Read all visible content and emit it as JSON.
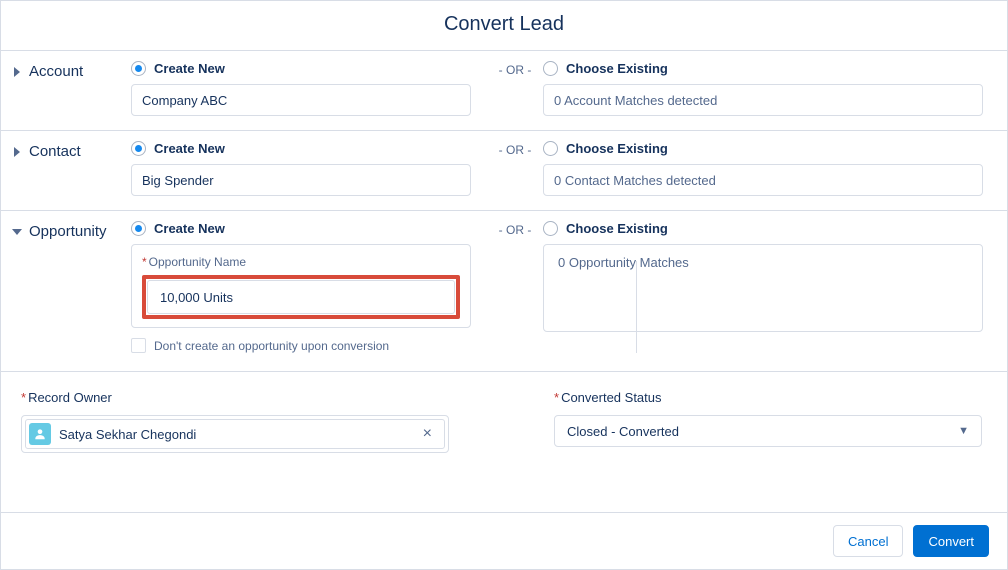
{
  "title": "Convert Lead",
  "or_label": "- OR -",
  "create_new_label": "Create New",
  "choose_existing_label": "Choose Existing",
  "account": {
    "label": "Account",
    "value": "Company ABC",
    "matches": "0 Account Matches detected"
  },
  "contact": {
    "label": "Contact",
    "value": "Big Spender",
    "matches": "0 Contact Matches detected"
  },
  "opportunity": {
    "label": "Opportunity",
    "name_label": "Opportunity Name",
    "value": "10,000 Units",
    "skip_label": "Don't create an opportunity upon conversion",
    "matches": "0 Opportunity Matches"
  },
  "recordOwner": {
    "label": "Record Owner",
    "value": "Satya Sekhar Chegondi"
  },
  "convertedStatus": {
    "label": "Converted Status",
    "value": "Closed - Converted"
  },
  "buttons": {
    "cancel": "Cancel",
    "convert": "Convert"
  }
}
